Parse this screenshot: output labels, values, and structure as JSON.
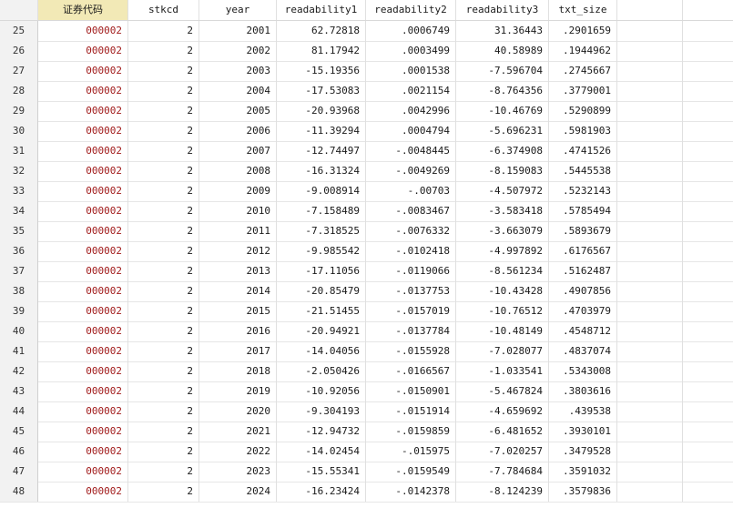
{
  "columns": [
    "证券代码",
    "stkcd",
    "year",
    "readability1",
    "readability2",
    "readability3",
    "txt_size"
  ],
  "rows": [
    {
      "n": "25",
      "cells": [
        "000002",
        "2",
        "2001",
        "62.72818",
        ".0006749",
        "31.36443",
        ".2901659"
      ]
    },
    {
      "n": "26",
      "cells": [
        "000002",
        "2",
        "2002",
        "81.17942",
        ".0003499",
        "40.58989",
        ".1944962"
      ]
    },
    {
      "n": "27",
      "cells": [
        "000002",
        "2",
        "2003",
        "-15.19356",
        ".0001538",
        "-7.596704",
        ".2745667"
      ]
    },
    {
      "n": "28",
      "cells": [
        "000002",
        "2",
        "2004",
        "-17.53083",
        ".0021154",
        "-8.764356",
        ".3779001"
      ]
    },
    {
      "n": "29",
      "cells": [
        "000002",
        "2",
        "2005",
        "-20.93968",
        ".0042996",
        "-10.46769",
        ".5290899"
      ]
    },
    {
      "n": "30",
      "cells": [
        "000002",
        "2",
        "2006",
        "-11.39294",
        ".0004794",
        "-5.696231",
        ".5981903"
      ]
    },
    {
      "n": "31",
      "cells": [
        "000002",
        "2",
        "2007",
        "-12.74497",
        "-.0048445",
        "-6.374908",
        ".4741526"
      ]
    },
    {
      "n": "32",
      "cells": [
        "000002",
        "2",
        "2008",
        "-16.31324",
        "-.0049269",
        "-8.159083",
        ".5445538"
      ]
    },
    {
      "n": "33",
      "cells": [
        "000002",
        "2",
        "2009",
        "-9.008914",
        "-.00703",
        "-4.507972",
        ".5232143"
      ]
    },
    {
      "n": "34",
      "cells": [
        "000002",
        "2",
        "2010",
        "-7.158489",
        "-.0083467",
        "-3.583418",
        ".5785494"
      ]
    },
    {
      "n": "35",
      "cells": [
        "000002",
        "2",
        "2011",
        "-7.318525",
        "-.0076332",
        "-3.663079",
        ".5893679"
      ]
    },
    {
      "n": "36",
      "cells": [
        "000002",
        "2",
        "2012",
        "-9.985542",
        "-.0102418",
        "-4.997892",
        ".6176567"
      ]
    },
    {
      "n": "37",
      "cells": [
        "000002",
        "2",
        "2013",
        "-17.11056",
        "-.0119066",
        "-8.561234",
        ".5162487"
      ]
    },
    {
      "n": "38",
      "cells": [
        "000002",
        "2",
        "2014",
        "-20.85479",
        "-.0137753",
        "-10.43428",
        ".4907856"
      ]
    },
    {
      "n": "39",
      "cells": [
        "000002",
        "2",
        "2015",
        "-21.51455",
        "-.0157019",
        "-10.76512",
        ".4703979"
      ]
    },
    {
      "n": "40",
      "cells": [
        "000002",
        "2",
        "2016",
        "-20.94921",
        "-.0137784",
        "-10.48149",
        ".4548712"
      ]
    },
    {
      "n": "41",
      "cells": [
        "000002",
        "2",
        "2017",
        "-14.04056",
        "-.0155928",
        "-7.028077",
        ".4837074"
      ]
    },
    {
      "n": "42",
      "cells": [
        "000002",
        "2",
        "2018",
        "-2.050426",
        "-.0166567",
        "-1.033541",
        ".5343008"
      ]
    },
    {
      "n": "43",
      "cells": [
        "000002",
        "2",
        "2019",
        "-10.92056",
        "-.0150901",
        "-5.467824",
        ".3803616"
      ]
    },
    {
      "n": "44",
      "cells": [
        "000002",
        "2",
        "2020",
        "-9.304193",
        "-.0151914",
        "-4.659692",
        ".439538"
      ]
    },
    {
      "n": "45",
      "cells": [
        "000002",
        "2",
        "2021",
        "-12.94732",
        "-.0159859",
        "-6.481652",
        ".3930101"
      ]
    },
    {
      "n": "46",
      "cells": [
        "000002",
        "2",
        "2022",
        "-14.02454",
        "-.015975",
        "-7.020257",
        ".3479528"
      ]
    },
    {
      "n": "47",
      "cells": [
        "000002",
        "2",
        "2023",
        "-15.55341",
        "-.0159549",
        "-7.784684",
        ".3591032"
      ]
    },
    {
      "n": "48",
      "cells": [
        "000002",
        "2",
        "2024",
        "-16.23424",
        "-.0142378",
        "-8.124239",
        ".3579836"
      ]
    }
  ],
  "colors": {
    "code_text": "#a11b1b",
    "selected_header": "#f2e9b6",
    "row_number_bg": "#f2f2f2"
  }
}
